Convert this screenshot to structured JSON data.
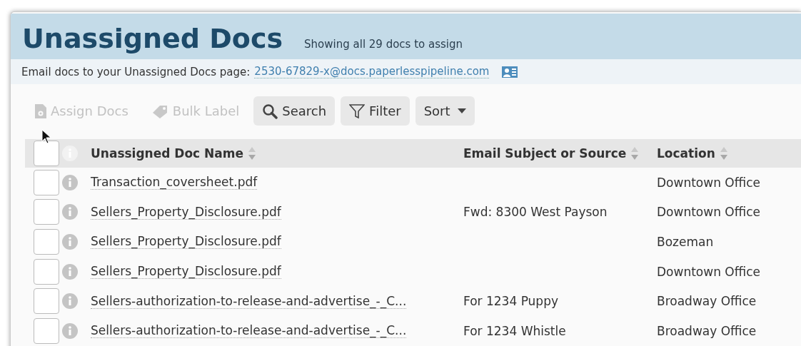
{
  "header": {
    "title": "Unassigned Docs",
    "subtitle": "Showing all 29 docs to assign"
  },
  "email_bar": {
    "label": "Email docs to your Unassigned Docs page:",
    "address": "2530-67829-x@docs.paperlesspipeline.com"
  },
  "toolbar": [
    {
      "kind": "assign",
      "label": "Assign Docs",
      "disabled": true
    },
    {
      "kind": "label",
      "label": "Bulk Label",
      "disabled": true
    },
    {
      "kind": "search",
      "label": "Search",
      "disabled": false
    },
    {
      "kind": "filter",
      "label": "Filter",
      "disabled": false
    },
    {
      "kind": "sort",
      "label": "Sort",
      "disabled": false
    }
  ],
  "table": {
    "select_all": {
      "checked": false
    },
    "columns": [
      "Unassigned Doc Name",
      "Email Subject or Source",
      "Location"
    ],
    "rows": [
      {
        "checked": false,
        "name": "Transaction_coversheet.pdf",
        "location": "Downtown Office"
      },
      {
        "checked": false,
        "name": "Sellers_Property_Disclosure.pdf",
        "source": "Fwd: 8300 West Payson",
        "location": "Downtown Office"
      },
      {
        "checked": false,
        "name": "Sellers_Property_Disclosure.pdf",
        "location": "Bozeman"
      },
      {
        "checked": false,
        "name": "Sellers_Property_Disclosure.pdf",
        "location": "Downtown Office"
      },
      {
        "checked": false,
        "name": "Sellers-authorization-to-release-and-advertise_-_C...",
        "source": "For 1234 Puppy",
        "location": "Broadway Office"
      },
      {
        "checked": false,
        "name": "Sellers-authorization-to-release-and-advertise_-_C...",
        "source": "For 1234 Whistle",
        "location": "Broadway Office"
      }
    ]
  }
}
